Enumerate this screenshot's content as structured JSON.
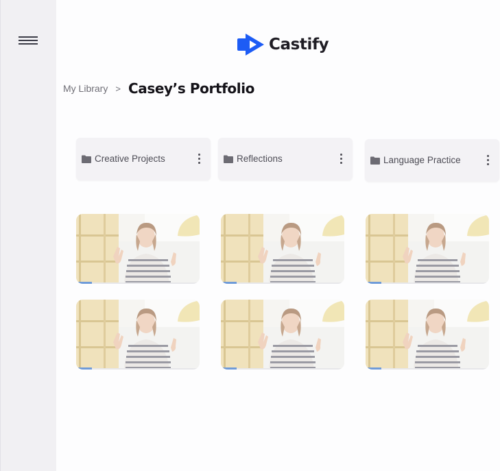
{
  "brand": {
    "name": "Castify",
    "icon": "castify-logo-icon",
    "accent": "#1d5cf5"
  },
  "sidebar": {
    "menu_icon": "hamburger-menu-icon"
  },
  "breadcrumb": {
    "parent": "My Library",
    "separator": ">",
    "current": "Casey’s Portfolio"
  },
  "folders": [
    {
      "label": "Creative Projects",
      "icon": "folder-icon"
    },
    {
      "label": "Reflections",
      "icon": "folder-icon"
    },
    {
      "label": "Language Practice",
      "icon": "folder-icon"
    }
  ],
  "videos": [
    {
      "thumbnail": "woman-waving-thumbnail",
      "progress": 0.13
    },
    {
      "thumbnail": "woman-waving-thumbnail",
      "progress": 0.13
    },
    {
      "thumbnail": "woman-waving-thumbnail",
      "progress": 0.13
    },
    {
      "thumbnail": "woman-waving-thumbnail",
      "progress": 0.13
    },
    {
      "thumbnail": "woman-waving-thumbnail",
      "progress": 0.13
    },
    {
      "thumbnail": "woman-waving-thumbnail",
      "progress": 0.13
    }
  ]
}
